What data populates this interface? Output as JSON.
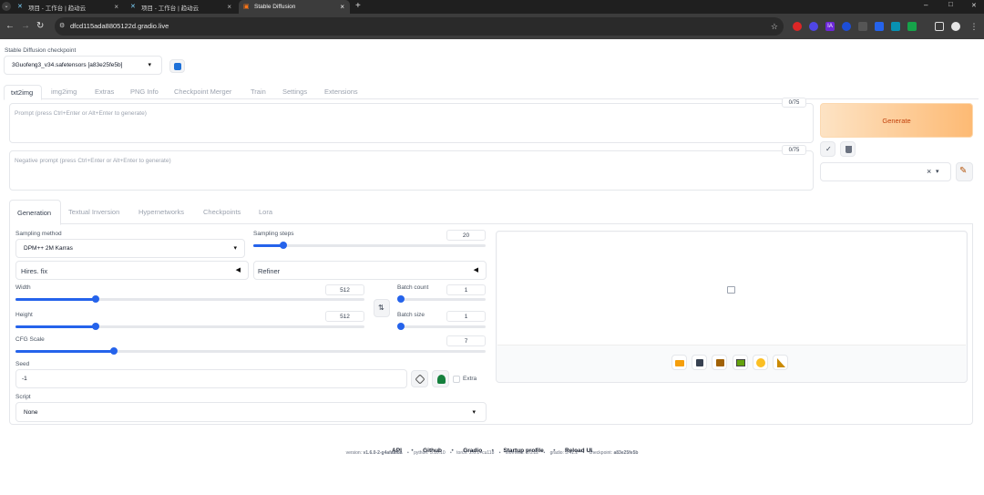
{
  "browser": {
    "tabs": [
      {
        "title": "项目 - 工作台 | 趋动云"
      },
      {
        "title": "项目 - 工作台 | 趋动云"
      },
      {
        "title": "Stable Diffusion"
      }
    ],
    "new_tab_glyph": "+",
    "url": "dfcd115ada8805122d.gradio.live",
    "window_controls": {
      "minimize": "–",
      "maximize": "□",
      "close": "✕"
    }
  },
  "checkpoint": {
    "label": "Stable Diffusion checkpoint",
    "value": "3Guofeng3_v34.safetensors [a83e25fe5b]"
  },
  "main_tabs": [
    "txt2img",
    "img2img",
    "Extras",
    "PNG Info",
    "Checkpoint Merger",
    "Train",
    "Settings",
    "Extensions"
  ],
  "prompt": {
    "placeholder": "Prompt (press Ctrl+Enter or Alt+Enter to generate)",
    "counter": "0/75"
  },
  "negative_prompt": {
    "placeholder": "Negative prompt (press Ctrl+Enter or Alt+Enter to generate)",
    "counter": "0/75"
  },
  "generate_label": "Generate",
  "style_actions": {
    "apply_glyph": "✓",
    "clear_glyph": "×",
    "dropdown_glyph": "▾"
  },
  "sub_tabs": [
    "Generation",
    "Textual Inversion",
    "Hypernetworks",
    "Checkpoints",
    "Lora"
  ],
  "sampling": {
    "method_label": "Sampling method",
    "method_value": "DPM++ 2M Karras",
    "steps_label": "Sampling steps",
    "steps_value": "20",
    "steps_fraction": 0.13
  },
  "hires_fix": {
    "label": "Hires. fix",
    "toggle_glyph": "◀"
  },
  "refiner": {
    "label": "Refiner",
    "toggle_glyph": "◀"
  },
  "width": {
    "label": "Width",
    "value": "512",
    "fraction": 0.23
  },
  "height": {
    "label": "Height",
    "value": "512",
    "fraction": 0.23
  },
  "batch_count": {
    "label": "Batch count",
    "value": "1",
    "fraction": 0.0
  },
  "batch_size": {
    "label": "Batch size",
    "value": "1",
    "fraction": 0.0
  },
  "cfg": {
    "label": "CFG Scale",
    "value": "7",
    "fraction": 0.21
  },
  "seed": {
    "label": "Seed",
    "value": "-1",
    "extra_label": "Extra"
  },
  "script": {
    "label": "Script",
    "value": "None"
  },
  "swap_glyph": "⇅",
  "footer": {
    "links": [
      "API",
      "Github",
      "Gradio",
      "Startup profile",
      "Reload UI"
    ],
    "separator": "•",
    "version_line": [
      {
        "k": "version: ",
        "v": "v1.6.0-2-g4afaaf8a"
      },
      {
        "k": "python: ",
        "v": "3.10.10"
      },
      {
        "k": "torch: ",
        "v": "2.0.1+cu118"
      },
      {
        "k": "xformers: ",
        "v": "0.0.22"
      },
      {
        "k": "gradio: ",
        "v": "3.41.2"
      },
      {
        "k": "checkpoint: ",
        "v": "a83e25fe5b"
      }
    ]
  },
  "colors": {
    "accent": "#2563eb",
    "generate_from": "#fde3c4",
    "generate_to": "#fdba74",
    "generate_text": "#c2410c"
  }
}
